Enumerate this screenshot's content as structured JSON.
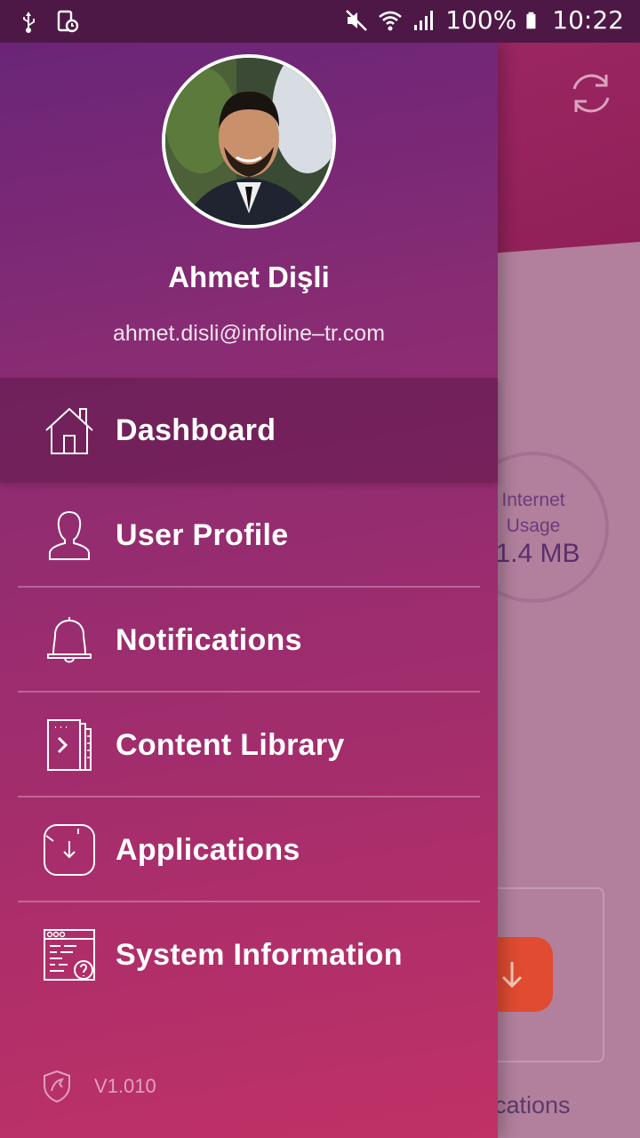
{
  "status_bar": {
    "battery": "100%",
    "time": "10:22"
  },
  "background": {
    "usage_title": "Internet Usage",
    "usage_value": "1.4 MB",
    "bottom_label": "ications"
  },
  "drawer": {
    "user_name": "Ahmet Dişli",
    "user_email": "ahmet.disli@infoline–tr.com",
    "menu": [
      {
        "label": "Dashboard",
        "icon": "home-icon",
        "active": true
      },
      {
        "label": "User Profile",
        "icon": "user-icon",
        "active": false
      },
      {
        "label": "Notifications",
        "icon": "bell-icon",
        "active": false
      },
      {
        "label": "Content Library",
        "icon": "book-icon",
        "active": false
      },
      {
        "label": "Applications",
        "icon": "app-download-icon",
        "active": false
      },
      {
        "label": "System Information",
        "icon": "system-info-icon",
        "active": false
      }
    ],
    "version": "V1.010"
  },
  "colors": {
    "drawer_top": "#6a2578",
    "drawer_bottom": "#c03166",
    "status_bar": "#4e1846",
    "accent_download": "#e04b31"
  }
}
